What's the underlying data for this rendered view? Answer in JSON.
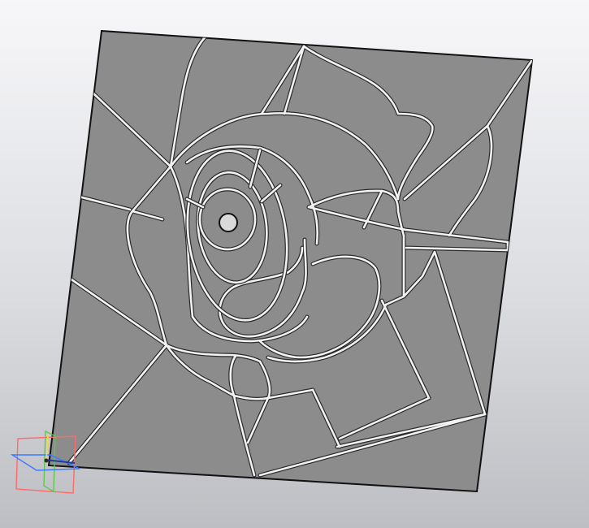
{
  "viewport": {
    "background_top": "#f7f7f9",
    "background_bottom": "#bdbec3"
  },
  "model": {
    "panel_fill": "#8c8c8c",
    "panel_edge": "#111111",
    "groove_color": "#f2f2f2",
    "groove_outline": "#2a2a2a",
    "hole_fill": "#d9d9d9"
  },
  "triad": {
    "plane_xy_color": "#3a7bff",
    "plane_yz_color": "#5ec84a",
    "plane_zx_color": "#ff6b6b",
    "icon": "coordinate-triad-icon"
  }
}
